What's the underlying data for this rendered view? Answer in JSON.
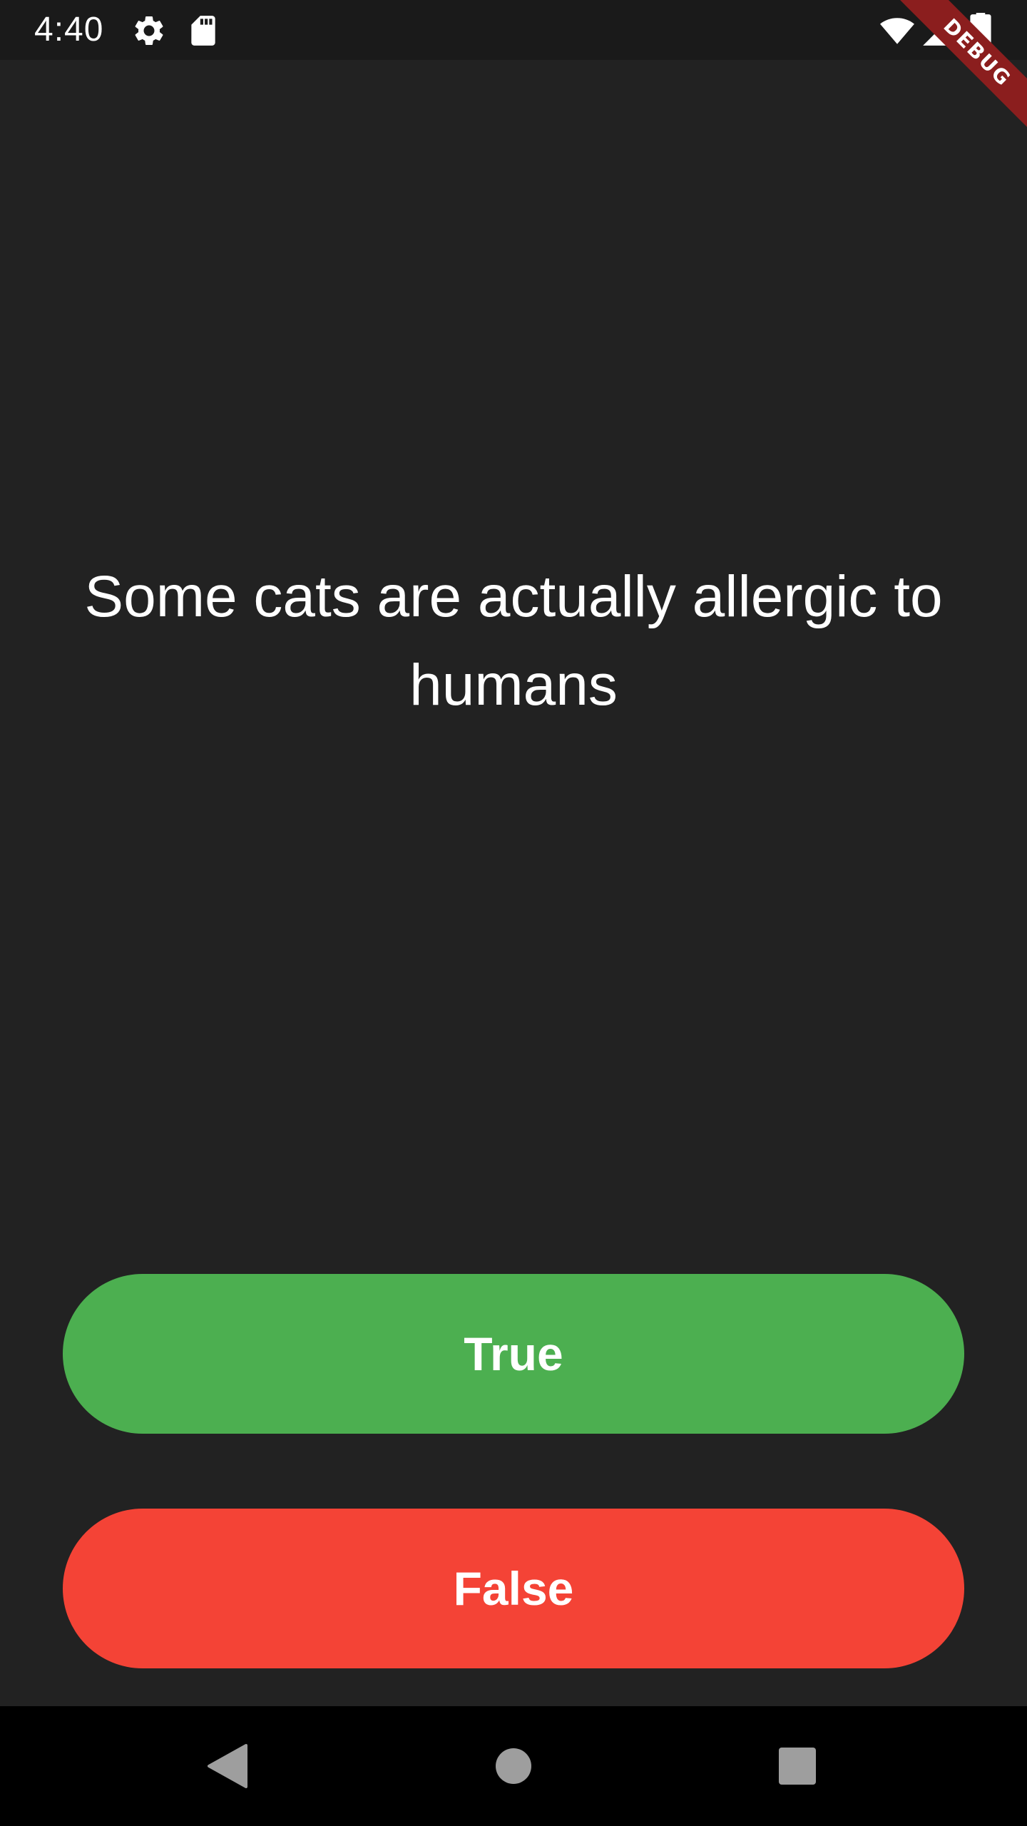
{
  "status_bar": {
    "time": "4:40",
    "icons": [
      "gear-icon",
      "sd-card-icon",
      "wifi-icon",
      "signal-icon",
      "battery-icon"
    ]
  },
  "debug_banner": {
    "label": "DEBUG"
  },
  "quiz": {
    "question": "Some cats are actually allergic to humans",
    "true_label": "True",
    "false_label": "False"
  },
  "colors": {
    "background": "#222222",
    "true_button": "#4caf50",
    "false_button": "#f44336",
    "debug_banner": "#8b1e1e"
  },
  "nav_bar": {
    "icons": [
      "back-icon",
      "home-icon",
      "recents-icon"
    ]
  }
}
